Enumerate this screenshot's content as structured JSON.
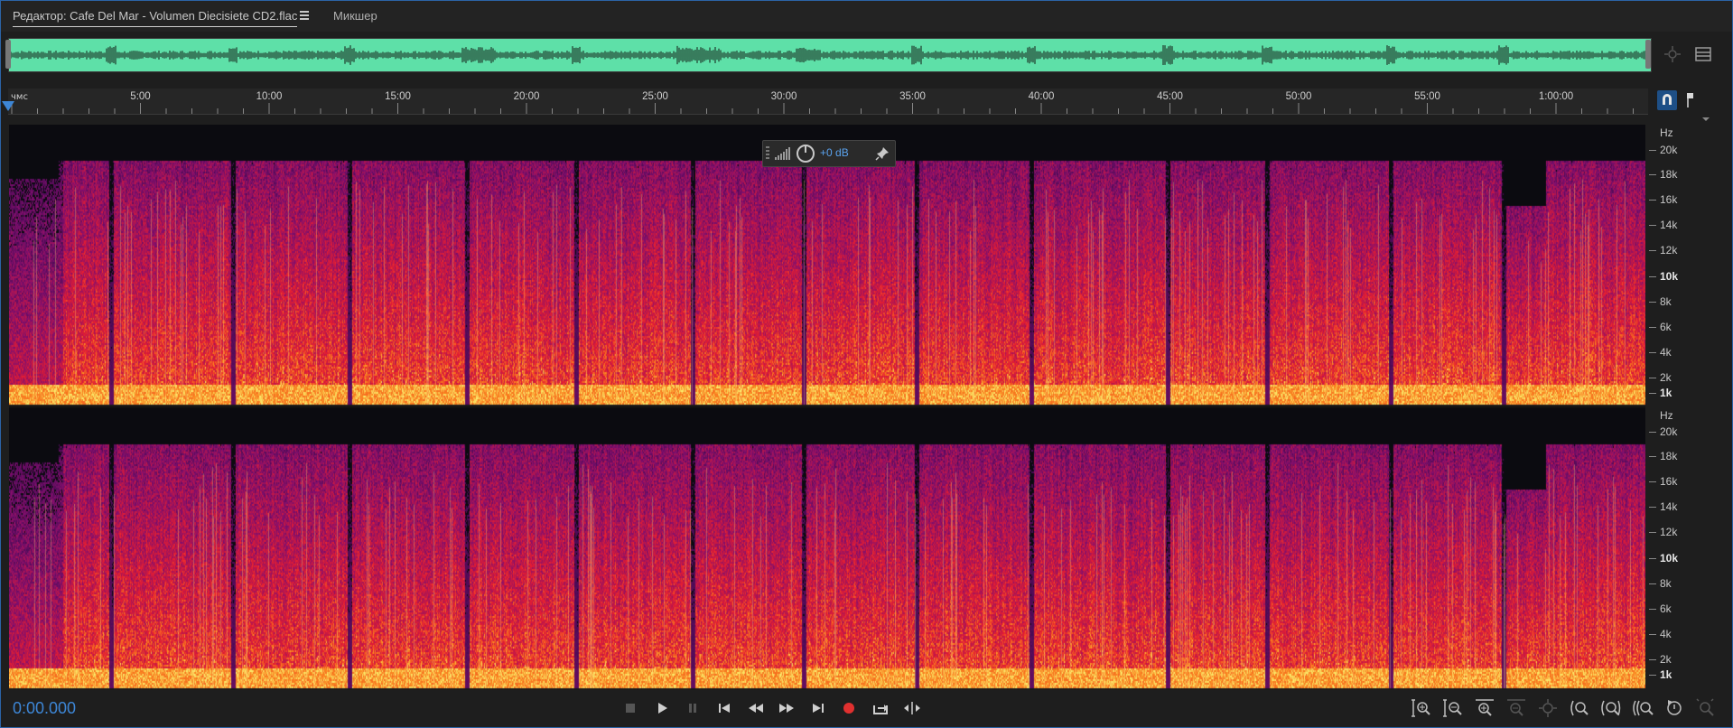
{
  "tabs": {
    "editor_label": "Редактор: Cafe Del Mar - Volumen Diecisiete CD2.flac",
    "mixer_label": "Микшер"
  },
  "ruler": {
    "unit_label": "чмс",
    "ticks": [
      "5:00",
      "10:00",
      "15:00",
      "20:00",
      "25:00",
      "30:00",
      "35:00",
      "40:00",
      "45:00",
      "50:00",
      "55:00",
      "1:00:00"
    ]
  },
  "hud": {
    "gain_label": "+0 dB"
  },
  "frequency_scale": {
    "unit": "Hz",
    "labels": [
      "20k",
      "18k",
      "16k",
      "14k",
      "12k",
      "10k",
      "8k",
      "6k",
      "4k",
      "2k",
      "1k"
    ]
  },
  "transport": {
    "time": "0:00.000",
    "buttons": [
      "stop-icon",
      "play-icon",
      "pause-icon",
      "go-to-start-icon",
      "rewind-icon",
      "fast-forward-icon",
      "go-to-end-icon",
      "record-icon",
      "loop-icon",
      "skip-selection-icon"
    ]
  },
  "zoom_controls": [
    "zoom-in-amplitude-icon",
    "zoom-out-amplitude-icon",
    "zoom-in-time-icon",
    "zoom-out-time-icon",
    "zoom-full-icon",
    "zoom-selection-icon",
    "zoom-in-left-icon",
    "zoom-in-right-icon",
    "zoom-reset-icon"
  ],
  "colors": {
    "accent": "#3d86d6",
    "overview_wave": "#5ee0a8",
    "spectrum_low": "#2a0b4a",
    "spectrum_mid": "#d2183a",
    "spectrum_high": "#ffe066",
    "record": "#e0302f"
  }
}
